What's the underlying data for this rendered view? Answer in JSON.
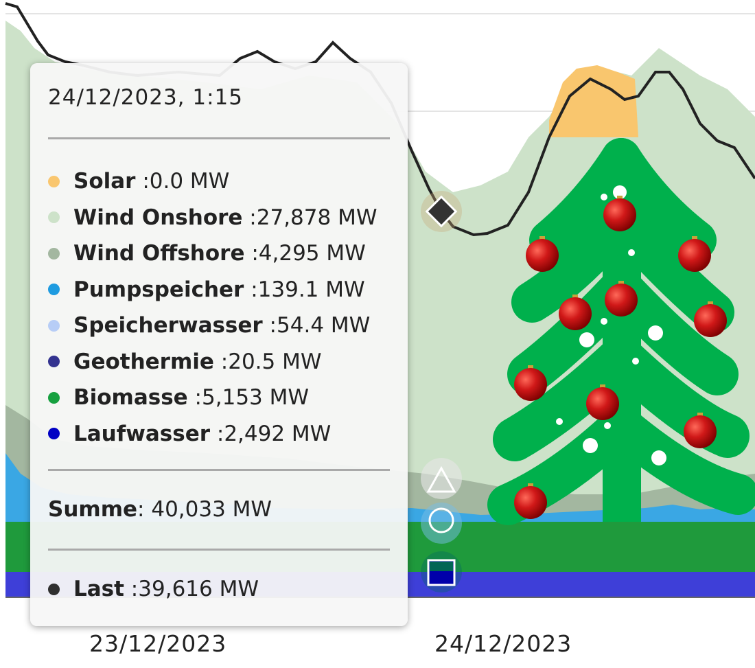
{
  "chart_data": {
    "type": "area",
    "x_ticks": [
      "23/12/2023",
      "24/12/2023"
    ],
    "stack_order": [
      "Laufwasser",
      "Biomasse",
      "Geothermie",
      "Speicherwasser",
      "Pumpspeicher",
      "Wind Offshore",
      "Wind Onshore",
      "Solar"
    ],
    "series": [
      {
        "name": "Solar",
        "color": "#f9c66e"
      },
      {
        "name": "Wind Onshore",
        "color": "#cde2c9"
      },
      {
        "name": "Wind Offshore",
        "color": "#a3b7a0"
      },
      {
        "name": "Pumpspeicher",
        "color": "#3aa7e4"
      },
      {
        "name": "Speicherwasser",
        "color": "#b7cdf6"
      },
      {
        "name": "Geothermie",
        "color": "#33338f"
      },
      {
        "name": "Biomasse",
        "color": "#1f9a3c"
      },
      {
        "name": "Laufwasser",
        "color": "#0000c4"
      }
    ],
    "load_series": {
      "name": "Last",
      "color": "#222222"
    },
    "background_color": "#ffffff"
  },
  "tooltip": {
    "date": "24/12/2023, 1:15",
    "rows": [
      {
        "name": "Solar",
        "value": "0.0 MW",
        "color": "#f9c66e"
      },
      {
        "name": "Wind Onshore",
        "value": "27,878 MW",
        "color": "#cde2c9"
      },
      {
        "name": "Wind Offshore",
        "value": "4,295 MW",
        "color": "#a3b7a0"
      },
      {
        "name": "Pumpspeicher",
        "value": "139.1 MW",
        "color": "#1e9be0"
      },
      {
        "name": "Speicherwasser",
        "value": "54.4 MW",
        "color": "#b7cdf6"
      },
      {
        "name": "Geothermie",
        "value": "20.5 MW",
        "color": "#33338f"
      },
      {
        "name": "Biomasse",
        "value": "5,153 MW",
        "color": "#16a03f"
      },
      {
        "name": "Laufwasser",
        "value": "2,492 MW",
        "color": "#0000c4"
      }
    ],
    "sum_label": "Summe",
    "sum_value": "40,033 MW",
    "load_label": "Last",
    "load_value": "39,616 MW",
    "load_color": "#2f2f2f"
  },
  "decoration": {
    "tree_color": "#00b04c",
    "ornament_color": "#d01818"
  }
}
